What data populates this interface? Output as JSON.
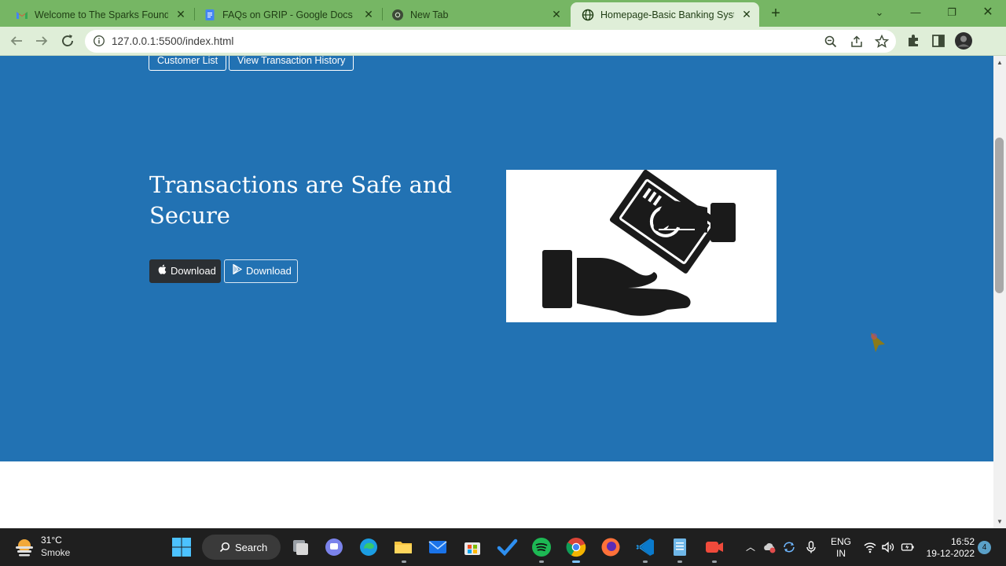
{
  "browser": {
    "tabs": [
      {
        "title": "Welcome to The Sparks Foundati",
        "favicon": "gmail-icon",
        "active": false
      },
      {
        "title": "FAQs on GRIP - Google Docs",
        "favicon": "docs-icon",
        "active": false
      },
      {
        "title": "New Tab",
        "favicon": "chrome-icon",
        "active": false
      },
      {
        "title": "Homepage-Basic Banking Systen",
        "favicon": "globe-icon",
        "active": true
      }
    ],
    "url": "127.0.0.1:5500/index.html",
    "colors": {
      "frame": "#76b664",
      "toolbar": "#dfeed8"
    }
  },
  "page": {
    "nav": {
      "customer_list": "Customer List",
      "transaction_history": "View Transaction History"
    },
    "hero": {
      "headline": "Transactions are Safe and Secure",
      "download_apple": "Download",
      "download_play": "Download",
      "background": "#2272b3",
      "image_icon": "hand-giving-money-icon"
    }
  },
  "taskbar": {
    "weather": {
      "temperature": "31°C",
      "condition": "Smoke"
    },
    "search_label": "Search",
    "language": {
      "line1": "ENG",
      "line2": "IN"
    },
    "clock": {
      "time": "16:52",
      "date": "19-12-2022"
    },
    "notification_count": "4"
  }
}
